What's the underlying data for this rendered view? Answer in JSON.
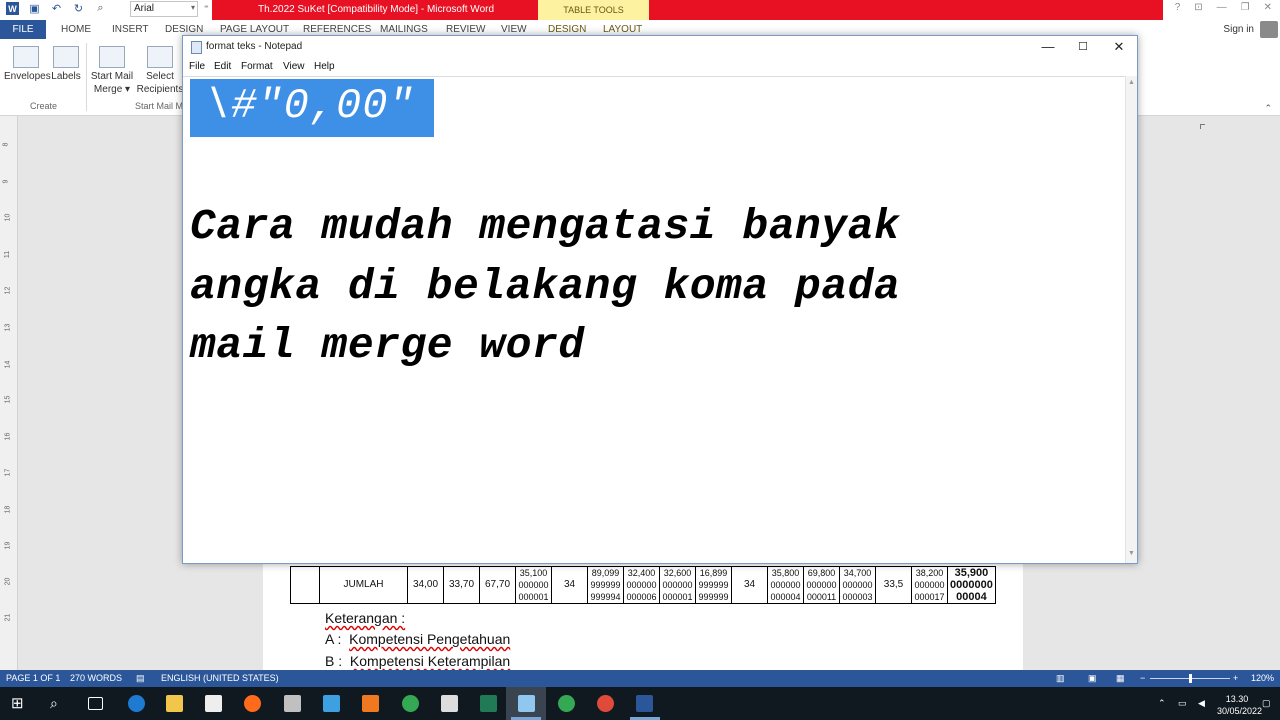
{
  "word": {
    "title": "Th.2022 SuKet [Compatibility Mode] - Microsoft Word",
    "contextual_tab": "TABLE TOOLS",
    "font": "Arial",
    "tabs": [
      "FILE",
      "HOME",
      "INSERT",
      "DESIGN",
      "PAGE LAYOUT",
      "REFERENCES",
      "MAILINGS",
      "REVIEW",
      "VIEW",
      "DESIGN",
      "LAYOUT"
    ],
    "sign_in": "Sign in",
    "window_controls": [
      "?",
      "⊡",
      "—",
      "❐",
      "✕"
    ],
    "ribbon": {
      "envelopes": "Envelopes",
      "labels": "Labels",
      "create_group": "Create",
      "start_mail_merge": "Start Mail",
      "start_mail_merge_2": "Merge ▾",
      "select_recipients": "Select",
      "select_recipients_2": "Recipients",
      "start_group": "Start Mail M"
    },
    "ruler_numbers": [
      "8",
      "9",
      "10",
      "11",
      "12",
      "13",
      "14",
      "15",
      "16",
      "17",
      "18",
      "19",
      "20",
      "21"
    ],
    "table_row": {
      "label": "JUMLAH",
      "cells": [
        "34,00",
        "33,70",
        "67,70",
        "35,100|000000|000001",
        "34",
        "89,099|999999|999994",
        "32,400|000000|000006",
        "32,600|000000|000001",
        "16,899|999999|999999",
        "34",
        "35,800|000000|000004",
        "69,800|000000|000011",
        "34,700|000000|000003",
        "33,5",
        "38,200|000000|000017",
        "35,900|0000000|00004"
      ]
    },
    "keterangan": {
      "heading": "Keterangan :",
      "a_label": "A :",
      "a_text": "Kompetensi Pengetahuan",
      "b_label": "B :",
      "b_text": "Kompetensi Keterampilan"
    },
    "status": {
      "page": "PAGE 1 OF 1",
      "words": "270 WORDS",
      "language": "ENGLISH (UNITED STATES)",
      "zoom": "120%",
      "zoom_fraction": 0.5
    }
  },
  "notepad": {
    "title": "format teks - Notepad",
    "menu": [
      "File",
      "Edit",
      "Format",
      "View",
      "Help"
    ],
    "selected_code": "\\#\"0,00\"",
    "line1": "Cara mudah mengatasi banyak",
    "line2": "angka di belakang koma pada",
    "line3": "mail merge word"
  },
  "taskbar": {
    "time": "13.30",
    "date": "30/05/2022"
  }
}
